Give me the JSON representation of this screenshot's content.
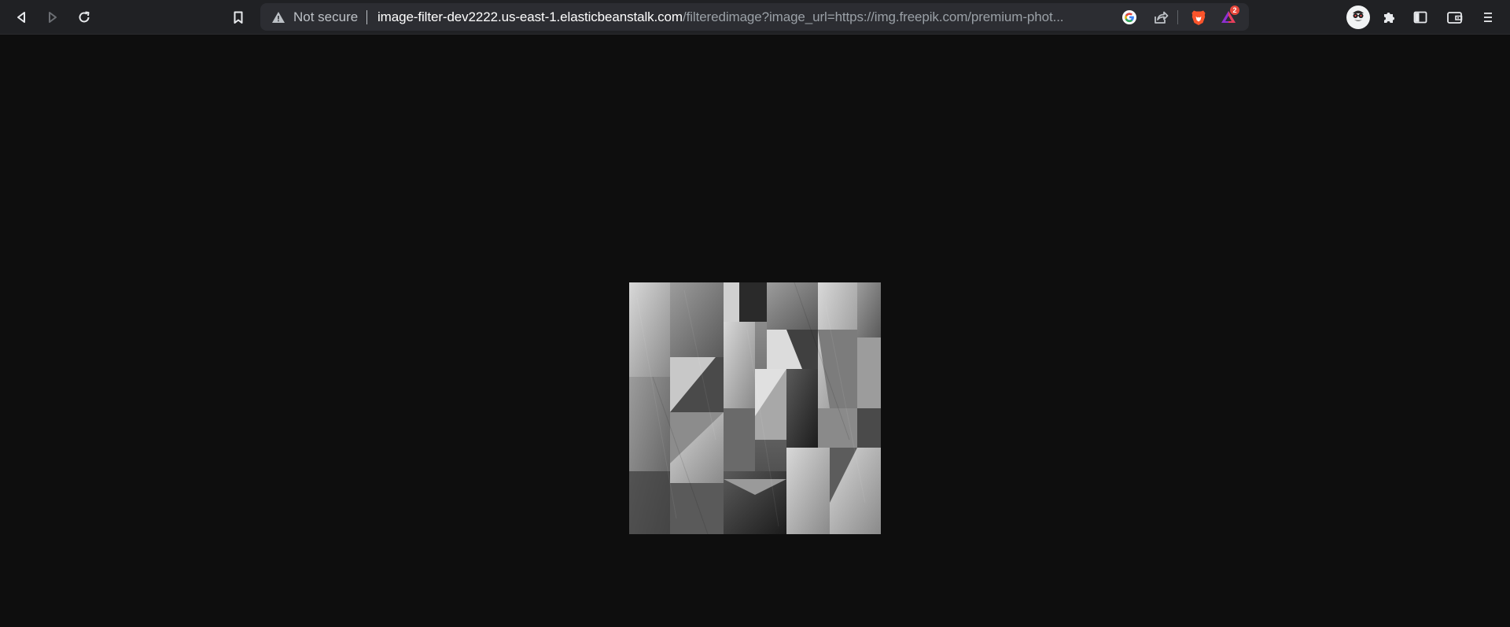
{
  "browser": {
    "security_label": "Not secure",
    "url_host": "image-filter-dev2222.us-east-1.elasticbeanstalk.com",
    "url_path": "/filteredimage?image_url=https://img.freepik.com/premium-phot...",
    "notification_count": "2",
    "icons": {
      "back": "back-arrow-icon",
      "forward": "forward-arrow-icon",
      "reload": "reload-icon",
      "bookmark": "bookmark-icon",
      "warning": "warning-triangle-icon",
      "google": "google-icon",
      "share": "share-icon",
      "brave_shields": "brave-lion-icon",
      "brave_rewards": "brave-rewards-icon",
      "profile": "profile-avatar-icon",
      "extensions": "puzzle-piece-icon",
      "sidebar": "sidebar-icon",
      "wallet": "wallet-icon",
      "menu": "hamburger-menu-icon"
    }
  },
  "page": {
    "image_description_icon": "grayscale-geometric-blocks-image",
    "background_color": "#0e0e0e"
  }
}
